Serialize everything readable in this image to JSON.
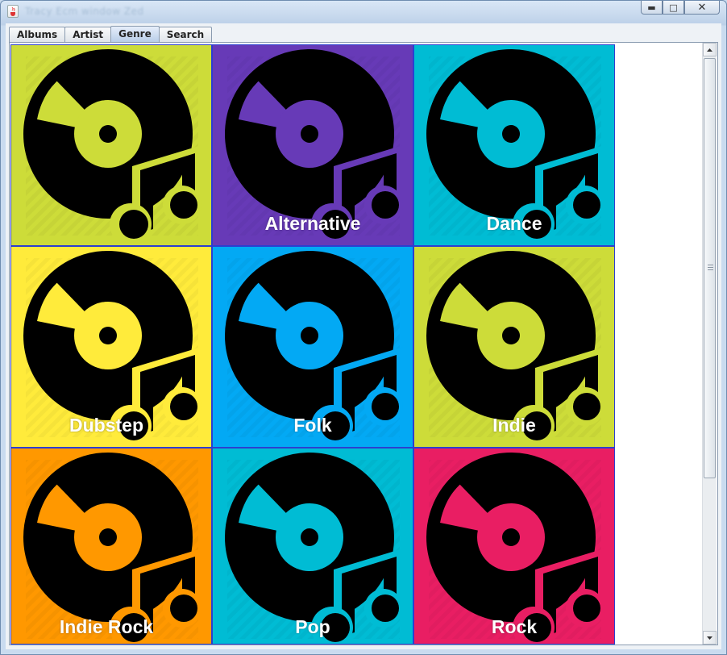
{
  "window": {
    "title": "Tracy Ecm window Zed"
  },
  "tabs": [
    {
      "label": "Albums",
      "active": false
    },
    {
      "label": "Artist",
      "active": false
    },
    {
      "label": "Genre",
      "active": true
    },
    {
      "label": "Search",
      "active": false
    }
  ],
  "genres": [
    {
      "label": "",
      "color": "#cddc39"
    },
    {
      "label": "Alternative",
      "color": "#673ab7"
    },
    {
      "label": "Dance",
      "color": "#00bcd4"
    },
    {
      "label": "Dubstep",
      "color": "#ffeb3b"
    },
    {
      "label": "Folk",
      "color": "#03a9f4"
    },
    {
      "label": "Indie",
      "color": "#cddc39"
    },
    {
      "label": "Indie Rock",
      "color": "#ff9800"
    },
    {
      "label": "Pop",
      "color": "#00bcd4"
    },
    {
      "label": "Rock",
      "color": "#e91e63"
    }
  ],
  "icons": {
    "tile_art": "vinyl-record-music-note-icon",
    "app": "java-cup-icon"
  }
}
